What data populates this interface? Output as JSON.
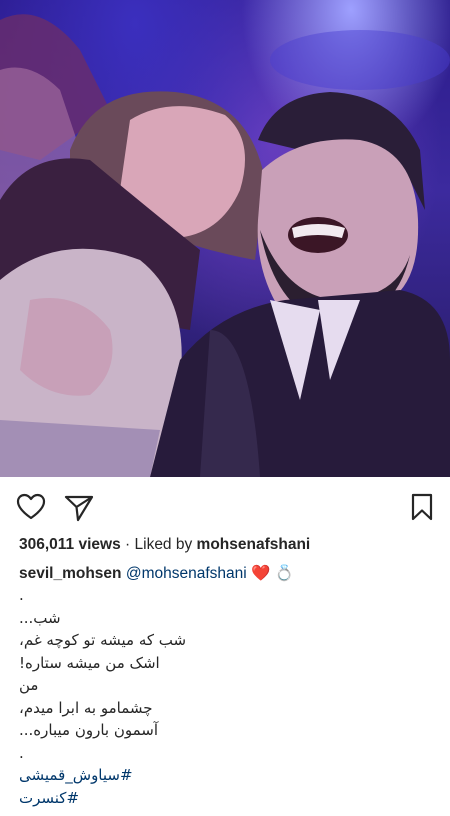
{
  "post": {
    "views_count": "306,011 views",
    "liked_by_prefix": "· Liked by",
    "liked_by_user": "mohsenafshani",
    "author": "sevil_mohsen",
    "mention": "@mohsenafshani",
    "emoji_heart": "❤️",
    "emoji_ring": "💍",
    "caption_lines": [
      ".",
      "شب...",
      "شب که میشه تو کوچه غم،",
      "اشک من میشه ستاره!",
      "من",
      "چشمامو به ابرا میدم،",
      "آسمون بارون میباره...",
      "."
    ],
    "hashtags": [
      "#سیاوش_قمیشی",
      "#کنسرت"
    ]
  },
  "icons": {
    "like": "heart-outline-icon",
    "share": "paper-plane-icon",
    "save": "bookmark-icon"
  }
}
